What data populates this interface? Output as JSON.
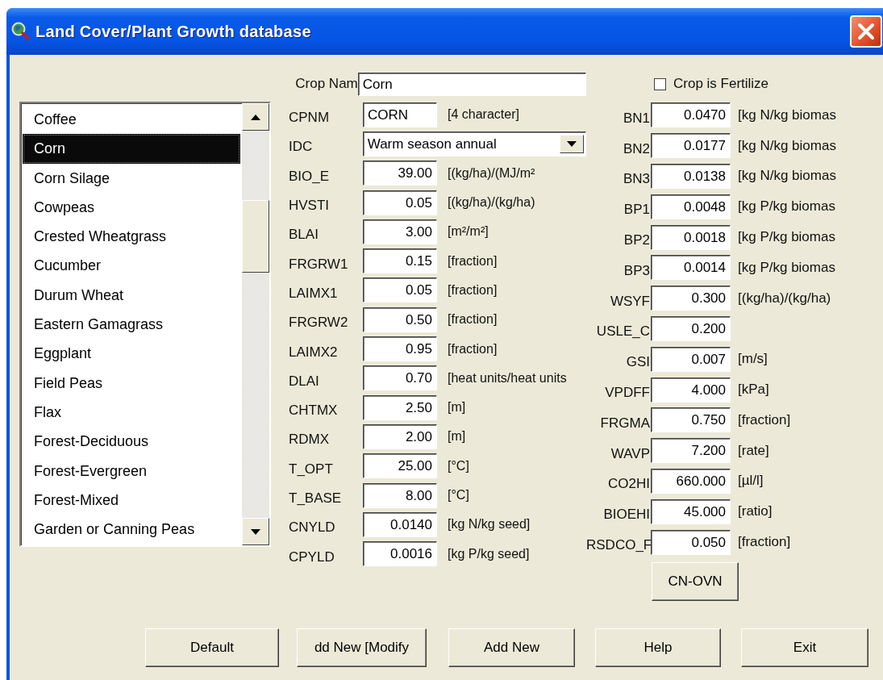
{
  "window": {
    "title": "Land Cover/Plant Growth database"
  },
  "crop_list": {
    "items": [
      {
        "label": "Coffee",
        "selected": false
      },
      {
        "label": "Corn",
        "selected": true
      },
      {
        "label": "Corn Silage",
        "selected": false
      },
      {
        "label": "Cowpeas",
        "selected": false
      },
      {
        "label": "Crested Wheatgrass",
        "selected": false
      },
      {
        "label": "Cucumber",
        "selected": false
      },
      {
        "label": "Durum Wheat",
        "selected": false
      },
      {
        "label": "Eastern Gamagrass",
        "selected": false
      },
      {
        "label": "Eggplant",
        "selected": false
      },
      {
        "label": "Field Peas",
        "selected": false
      },
      {
        "label": "Flax",
        "selected": false
      },
      {
        "label": "Forest-Deciduous",
        "selected": false
      },
      {
        "label": "Forest-Evergreen",
        "selected": false
      },
      {
        "label": "Forest-Mixed",
        "selected": false
      },
      {
        "label": "Garden or Canning Peas",
        "selected": false
      }
    ]
  },
  "crop_name": {
    "label": "Crop Nam",
    "value": "Corn"
  },
  "fertilize": {
    "label": "Crop is Fertilize",
    "checked": false
  },
  "left_params": [
    {
      "kind": "text",
      "label": "CPNM",
      "value": "CORN",
      "unit": "[4 character]"
    },
    {
      "kind": "dropdown",
      "label": "IDC",
      "value": "Warm season annual"
    },
    {
      "kind": "number",
      "label": "BIO_E",
      "value": "39.00",
      "unit": "[(kg/ha)/(MJ/m²"
    },
    {
      "kind": "number",
      "label": "HVSTI",
      "value": "0.05",
      "unit": "[(kg/ha)/(kg/ha)"
    },
    {
      "kind": "number",
      "label": "BLAI",
      "value": "3.00",
      "unit": "[m²/m²]"
    },
    {
      "kind": "number",
      "label": "FRGRW1",
      "value": "0.15",
      "unit": "[fraction]"
    },
    {
      "kind": "number",
      "label": "LAIMX1",
      "value": "0.05",
      "unit": "[fraction]"
    },
    {
      "kind": "number",
      "label": "FRGRW2",
      "value": "0.50",
      "unit": "[fraction]"
    },
    {
      "kind": "number",
      "label": "LAIMX2",
      "value": "0.95",
      "unit": "[fraction]"
    },
    {
      "kind": "number",
      "label": "DLAI",
      "value": "0.70",
      "unit": "[heat units/heat units"
    },
    {
      "kind": "number",
      "label": "CHTMX",
      "value": "2.50",
      "unit": "[m]"
    },
    {
      "kind": "number",
      "label": "RDMX",
      "value": "2.00",
      "unit": "[m]"
    },
    {
      "kind": "number",
      "label": "T_OPT",
      "value": "25.00",
      "unit": "[°C]"
    },
    {
      "kind": "number",
      "label": "T_BASE",
      "value": "8.00",
      "unit": "[°C]"
    },
    {
      "kind": "number",
      "label": "CNYLD",
      "value": "0.0140",
      "unit": "[kg N/kg seed]"
    },
    {
      "kind": "number",
      "label": "CPYLD",
      "value": "0.0016",
      "unit": "[kg P/kg seed]"
    }
  ],
  "right_params": [
    {
      "kind": "number",
      "label": "BN1",
      "value": "0.0470",
      "unit": "[kg N/kg biomas"
    },
    {
      "kind": "number",
      "label": "BN2",
      "value": "0.0177",
      "unit": "[kg N/kg biomas"
    },
    {
      "kind": "number",
      "label": "BN3",
      "value": "0.0138",
      "unit": "[kg N/kg biomas"
    },
    {
      "kind": "number",
      "label": "BP1",
      "value": "0.0048",
      "unit": "[kg P/kg biomas"
    },
    {
      "kind": "number",
      "label": "BP2",
      "value": "0.0018",
      "unit": "[kg P/kg biomas"
    },
    {
      "kind": "number",
      "label": "BP3",
      "value": "0.0014",
      "unit": "[kg P/kg biomas"
    },
    {
      "kind": "number",
      "label": "WSYF",
      "value": "0.300",
      "unit": "[(kg/ha)/(kg/ha)"
    },
    {
      "kind": "number",
      "label": "USLE_C",
      "value": "0.200"
    },
    {
      "kind": "number",
      "label": "GSI",
      "value": "0.007",
      "unit": "[m/s]"
    },
    {
      "kind": "number",
      "label": "VPDFF",
      "value": "4.000",
      "unit": "[kPa]"
    },
    {
      "kind": "number",
      "label": "FRGMA",
      "value": "0.750",
      "unit": "[fraction]"
    },
    {
      "kind": "number",
      "label": "WAVP",
      "value": "7.200",
      "unit": "[rate]"
    },
    {
      "kind": "number",
      "label": "CO2HI",
      "value": "660.000",
      "unit": "[µl/l]"
    },
    {
      "kind": "number",
      "label": "BIOEHI",
      "value": "45.000",
      "unit": "[ratio]"
    },
    {
      "kind": "number",
      "label": "RSDCO_F",
      "value": "0.050",
      "unit": "[fraction]"
    }
  ],
  "cn_ovn_button": "CN-OVN",
  "buttons": [
    "Default",
    "dd New [Modify",
    "Add New",
    "Help",
    "Exit"
  ]
}
